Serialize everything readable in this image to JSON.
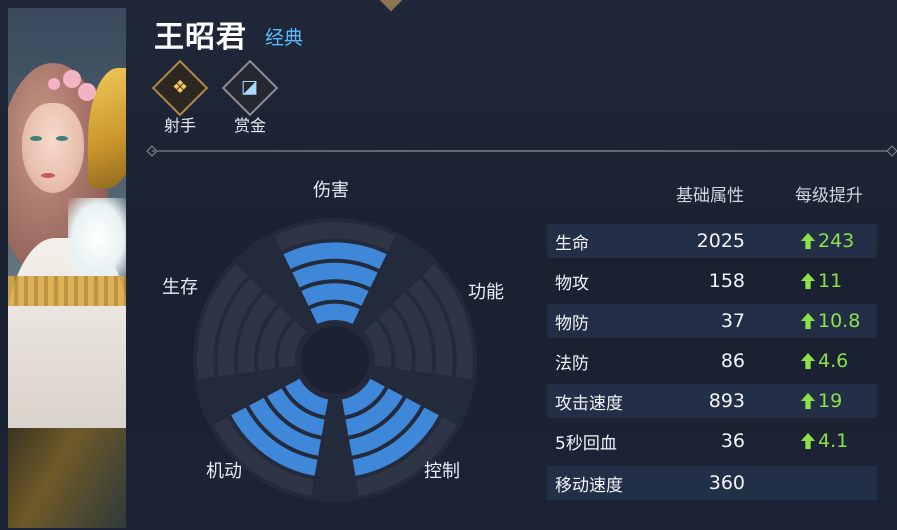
{
  "hero": {
    "name": "王昭君",
    "skin": "经典",
    "roles": [
      {
        "label": "射手",
        "icon": "marksman-icon"
      },
      {
        "label": "赏金",
        "icon": "bounty-icon"
      }
    ]
  },
  "radar": {
    "labels": {
      "damage": "伤害",
      "utility": "功能",
      "control": "控制",
      "mobility": "机动",
      "survival": "生存"
    },
    "levels_filled": {
      "damage": 4,
      "utility": 0,
      "control": 4,
      "mobility": 4,
      "survival": 0
    },
    "levels_total": 5,
    "filled_color": "#3f87d8",
    "empty_color": "#2e3547"
  },
  "stats": {
    "header_base": "基础属性",
    "header_growth": "每级提升",
    "rows": [
      {
        "name": "生命",
        "value": "2025",
        "growth": "243"
      },
      {
        "name": "物攻",
        "value": "158",
        "growth": "11"
      },
      {
        "name": "物防",
        "value": "37",
        "growth": "10.8"
      },
      {
        "name": "法防",
        "value": "86",
        "growth": "4.6"
      },
      {
        "name": "攻击速度",
        "value": "893",
        "growth": "19"
      },
      {
        "name": "5秒回血",
        "value": "36",
        "growth": "4.1"
      },
      {
        "name": "移动速度",
        "value": "360",
        "growth": ""
      }
    ],
    "growth_color": "#8de04a"
  }
}
